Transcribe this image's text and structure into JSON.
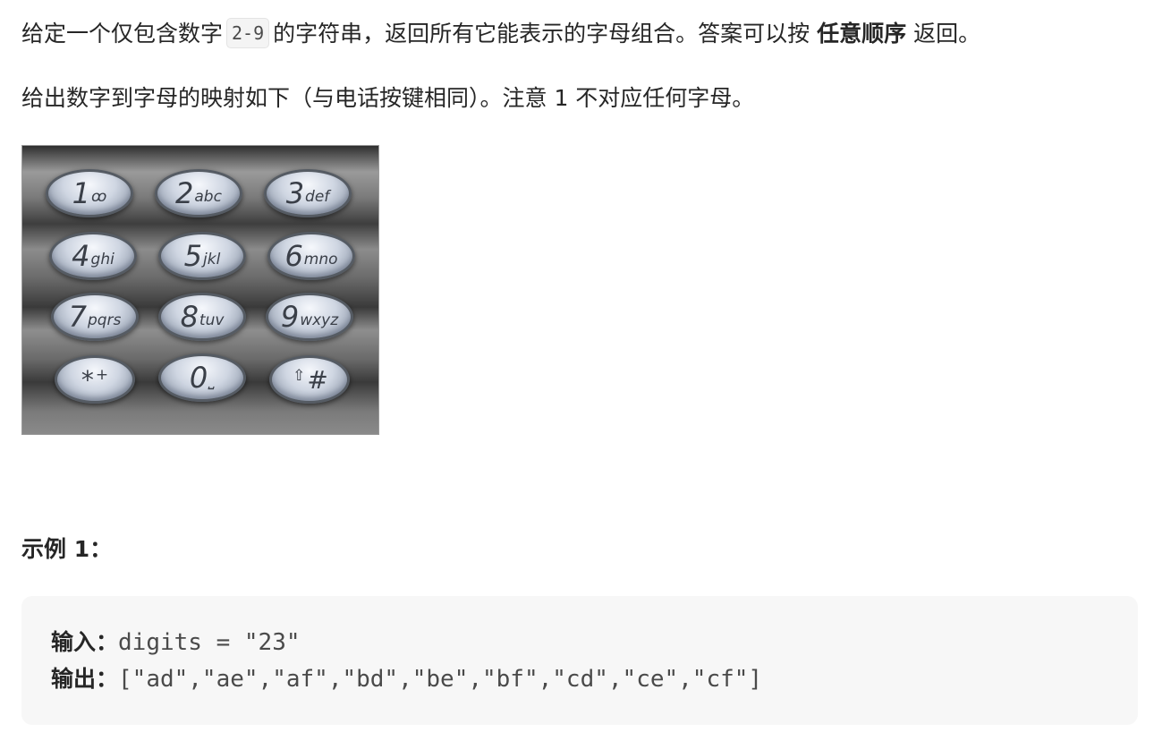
{
  "problem": {
    "line1_before": "给定一个仅包含数字",
    "line1_code": "2-9",
    "line1_middle": "的字符串，返回所有它能表示的字母组合。答案可以按",
    "line1_bold": "任意顺序",
    "line1_after": "返回。",
    "line2": "给出数字到字母的映射如下（与电话按键相同）。注意 1 不对应任何字母。"
  },
  "keypad": {
    "keys": [
      {
        "digit": "1",
        "letters": "ꝏ"
      },
      {
        "digit": "2",
        "letters": "abc"
      },
      {
        "digit": "3",
        "letters": "def"
      },
      {
        "digit": "4",
        "letters": "ghi"
      },
      {
        "digit": "5",
        "letters": "jkl"
      },
      {
        "digit": "6",
        "letters": "mno"
      },
      {
        "digit": "7",
        "letters": "pqrs"
      },
      {
        "digit": "8",
        "letters": "tuv"
      },
      {
        "digit": "9",
        "letters": "wxyz"
      },
      {
        "digit": "*",
        "letters": "+"
      },
      {
        "digit": "0",
        "letters": "⎵"
      },
      {
        "digit": "#",
        "letters": "⇧"
      }
    ]
  },
  "example": {
    "title": "示例 1：",
    "input_label": "输入：",
    "input_value": "digits = \"23\"",
    "output_label": "输出：",
    "output_value": "[\"ad\",\"ae\",\"af\",\"bd\",\"be\",\"bf\",\"cd\",\"ce\",\"cf\"]"
  }
}
